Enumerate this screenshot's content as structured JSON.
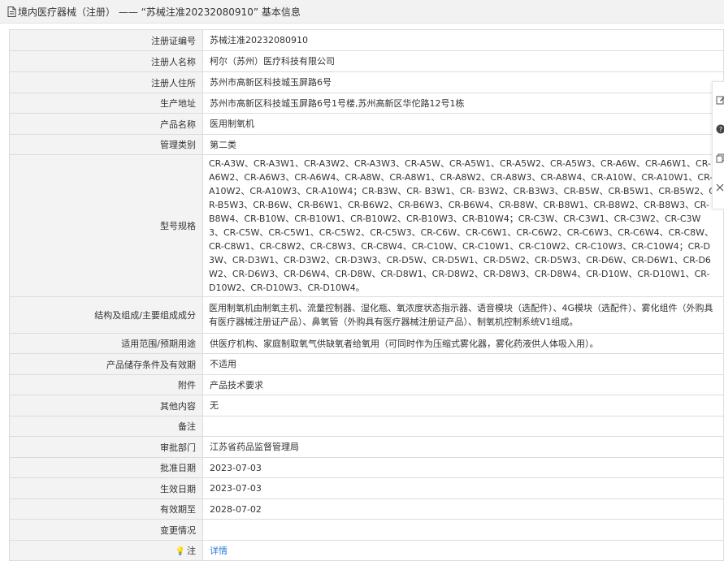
{
  "header": {
    "title": "境内医疗器械（注册） —— “苏械注准20232080910” 基本信息"
  },
  "rows": [
    {
      "label": "注册证编号",
      "value": "苏械注准20232080910"
    },
    {
      "label": "注册人名称",
      "value": "柯尔（苏州）医疗科技有限公司"
    },
    {
      "label": "注册人住所",
      "value": "苏州市高新区科技城玉屏路6号"
    },
    {
      "label": "生产地址",
      "value": "苏州市高新区科技城玉屏路6号1号楼,苏州高新区华佗路12号1栋"
    },
    {
      "label": "产品名称",
      "value": "医用制氧机"
    },
    {
      "label": "管理类别",
      "value": "第二类"
    },
    {
      "label": "型号规格",
      "value": "CR-A3W、CR-A3W1、CR-A3W2、CR-A3W3、CR-A5W、CR-A5W1、CR-A5W2、CR-A5W3、CR-A6W、CR-A6W1、CR-A6W2、CR-A6W3、CR-A6W4、CR-A8W、CR-A8W1、CR-A8W2、CR-A8W3、CR-A8W4、CR-A10W、CR-A10W1、CR-A10W2、CR-A10W3、CR-A10W4；CR-B3W、CR- B3W1、CR- B3W2、CR-B3W3、CR-B5W、CR-B5W1、CR-B5W2、CR-B5W3、CR-B6W、CR-B6W1、CR-B6W2、CR-B6W3、CR-B6W4、CR-B8W、CR-B8W1、CR-B8W2、CR-B8W3、CR-B8W4、CR-B10W、CR-B10W1、CR-B10W2、CR-B10W3、CR-B10W4；CR-C3W、CR-C3W1、CR-C3W2、CR-C3W3、CR-C5W、CR-C5W1、CR-C5W2、CR-C5W3、CR-C6W、CR-C6W1、CR-C6W2、CR-C6W3、CR-C6W4、CR-C8W、CR-C8W1、CR-C8W2、CR-C8W3、CR-C8W4、CR-C10W、CR-C10W1、CR-C10W2、CR-C10W3、CR-C10W4；CR-D3W、CR-D3W1、CR-D3W2、CR-D3W3、CR-D5W、CR-D5W1、CR-D5W2、CR-D5W3、CR-D6W、CR-D6W1、CR-D6W2、CR-D6W3、CR-D6W4、CR-D8W、CR-D8W1、CR-D8W2、CR-D8W3、CR-D8W4、CR-D10W、CR-D10W1、CR-D10W2、CR-D10W3、CR-D10W4。"
    },
    {
      "label": "结构及组成/主要组成成分",
      "value": "医用制氧机由制氧主机、流量控制器、湿化瓶、氧浓度状态指示器、语音模块（选配件）、4G模块（选配件）、雾化组件（外购具有医疗器械注册证产品）、鼻氧管（外购具有医疗器械注册证产品）、制氧机控制系统V1组成。"
    },
    {
      "label": "适用范围/预期用途",
      "value": "供医疗机构、家庭制取氧气供缺氧者给氧用（可同时作为压缩式雾化器，雾化药液供人体吸入用）。"
    },
    {
      "label": "产品储存条件及有效期",
      "value": "不适用"
    },
    {
      "label": "附件",
      "value": "产品技术要求"
    },
    {
      "label": "其他内容",
      "value": "无"
    },
    {
      "label": "备注",
      "value": ""
    },
    {
      "label": "审批部门",
      "value": "江苏省药品监督管理局"
    },
    {
      "label": "批准日期",
      "value": "2023-07-03"
    },
    {
      "label": "生效日期",
      "value": "2023-07-03"
    },
    {
      "label": "有效期至",
      "value": "2028-07-02"
    },
    {
      "label": "变更情况",
      "value": ""
    }
  ],
  "note_row": {
    "label": "注",
    "link_text": "详情"
  },
  "sidebar": {
    "icons": [
      "edit-icon",
      "help-icon",
      "copy-icon",
      "close-icon"
    ]
  },
  "colors": {
    "header_bg": "#f2f2f2",
    "label_bg": "#f3f3f3",
    "border": "#dcdcdc",
    "link": "#2a7bd8"
  }
}
